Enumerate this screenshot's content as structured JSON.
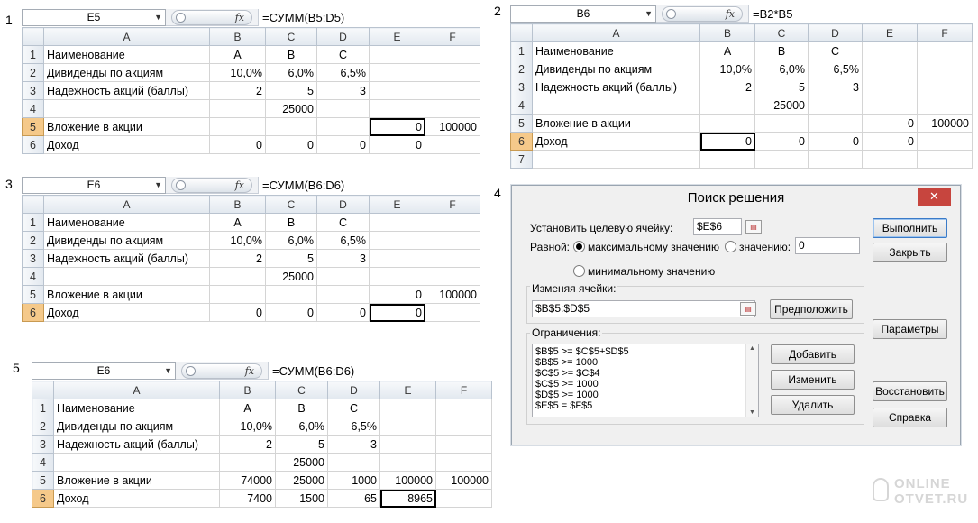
{
  "labels": {
    "p1": "1",
    "p2": "2",
    "p3": "3",
    "p4": "4",
    "p5": "5"
  },
  "col_headers": [
    "A",
    "B",
    "C",
    "D",
    "E",
    "F"
  ],
  "fx_symbol": "fx",
  "ss1": {
    "namebox": "E5",
    "formula": "=СУММ(B5:D5)",
    "rows": [
      {
        "n": "1",
        "a": "Наименование",
        "b": "A",
        "c": "B",
        "d": "C",
        "e": "",
        "f": ""
      },
      {
        "n": "2",
        "a": "Дивиденды по акциям",
        "b": "10,0%",
        "c": "6,0%",
        "d": "6,5%",
        "e": "",
        "f": ""
      },
      {
        "n": "3",
        "a": "Надежность акций (баллы)",
        "b": "2",
        "c": "5",
        "d": "3",
        "e": "",
        "f": ""
      },
      {
        "n": "4",
        "a": "",
        "b": "",
        "c": "25000",
        "d": "",
        "e": "",
        "f": ""
      },
      {
        "n": "5",
        "a": "Вложение в акции",
        "b": "",
        "c": "",
        "d": "",
        "e": "0",
        "f": "100000"
      },
      {
        "n": "6",
        "a": "Доход",
        "b": "0",
        "c": "0",
        "d": "0",
        "e": "0",
        "f": ""
      }
    ]
  },
  "ss2": {
    "namebox": "B6",
    "formula": "=B2*B5",
    "rows": [
      {
        "n": "1",
        "a": "Наименование",
        "b": "A",
        "c": "B",
        "d": "C",
        "e": "",
        "f": ""
      },
      {
        "n": "2",
        "a": "Дивиденды по акциям",
        "b": "10,0%",
        "c": "6,0%",
        "d": "6,5%",
        "e": "",
        "f": ""
      },
      {
        "n": "3",
        "a": "Надежность акций (баллы)",
        "b": "2",
        "c": "5",
        "d": "3",
        "e": "",
        "f": ""
      },
      {
        "n": "4",
        "a": "",
        "b": "",
        "c": "25000",
        "d": "",
        "e": "",
        "f": ""
      },
      {
        "n": "5",
        "a": "Вложение в акции",
        "b": "",
        "c": "",
        "d": "",
        "e": "0",
        "f": "100000"
      },
      {
        "n": "6",
        "a": "Доход",
        "b": "0",
        "c": "0",
        "d": "0",
        "e": "0",
        "f": ""
      },
      {
        "n": "7",
        "a": "",
        "b": "",
        "c": "",
        "d": "",
        "e": "",
        "f": ""
      }
    ]
  },
  "ss3": {
    "namebox": "E6",
    "formula": "=СУММ(B6:D6)",
    "rows": [
      {
        "n": "1",
        "a": "Наименование",
        "b": "A",
        "c": "B",
        "d": "C",
        "e": "",
        "f": ""
      },
      {
        "n": "2",
        "a": "Дивиденды по акциям",
        "b": "10,0%",
        "c": "6,0%",
        "d": "6,5%",
        "e": "",
        "f": ""
      },
      {
        "n": "3",
        "a": "Надежность акций (баллы)",
        "b": "2",
        "c": "5",
        "d": "3",
        "e": "",
        "f": ""
      },
      {
        "n": "4",
        "a": "",
        "b": "",
        "c": "25000",
        "d": "",
        "e": "",
        "f": ""
      },
      {
        "n": "5",
        "a": "Вложение в акции",
        "b": "",
        "c": "",
        "d": "",
        "e": "0",
        "f": "100000"
      },
      {
        "n": "6",
        "a": "Доход",
        "b": "0",
        "c": "0",
        "d": "0",
        "e": "0",
        "f": ""
      }
    ]
  },
  "ss5": {
    "namebox": "E6",
    "formula": "=СУММ(B6:D6)",
    "rows": [
      {
        "n": "1",
        "a": "Наименование",
        "b": "A",
        "c": "B",
        "d": "C",
        "e": "",
        "f": ""
      },
      {
        "n": "2",
        "a": "Дивиденды по акциям",
        "b": "10,0%",
        "c": "6,0%",
        "d": "6,5%",
        "e": "",
        "f": ""
      },
      {
        "n": "3",
        "a": "Надежность акций (баллы)",
        "b": "2",
        "c": "5",
        "d": "3",
        "e": "",
        "f": ""
      },
      {
        "n": "4",
        "a": "",
        "b": "",
        "c": "25000",
        "d": "",
        "e": "",
        "f": ""
      },
      {
        "n": "5",
        "a": "Вложение в акции",
        "b": "74000",
        "c": "25000",
        "d": "1000",
        "e": "100000",
        "f": "100000"
      },
      {
        "n": "6",
        "a": "Доход",
        "b": "7400",
        "c": "1500",
        "d": "65",
        "e": "8965",
        "f": ""
      }
    ]
  },
  "solver": {
    "title": "Поиск решения",
    "close_glyph": "✕",
    "target_label": "Установить целевую ячейку:",
    "target_value": "$E$6",
    "equal_label": "Равной:",
    "max_label": "максимальному значению",
    "value_label": "значению:",
    "value_input": "0",
    "min_label": "минимальному значению",
    "changing_label": "Изменяя ячейки:",
    "changing_value": "$B$5:$D$5",
    "guess_button": "Предположить",
    "constraints_label": "Ограничения:",
    "constraints": [
      "$B$5 >= $C$5+$D$5",
      "$B$5 >= 1000",
      "$C$5 >= $C$4",
      "$C$5 >= 1000",
      "$D$5 >= 1000",
      "$E$5 = $F$5"
    ],
    "add_button": "Добавить",
    "change_button": "Изменить",
    "delete_button": "Удалить",
    "run_button": "Выполнить",
    "close_button": "Закрыть",
    "params_button": "Параметры",
    "restore_button": "Восстановить",
    "help_button": "Справка"
  },
  "watermark": {
    "line1": "ONLINE",
    "line2": "OTVET.RU"
  }
}
